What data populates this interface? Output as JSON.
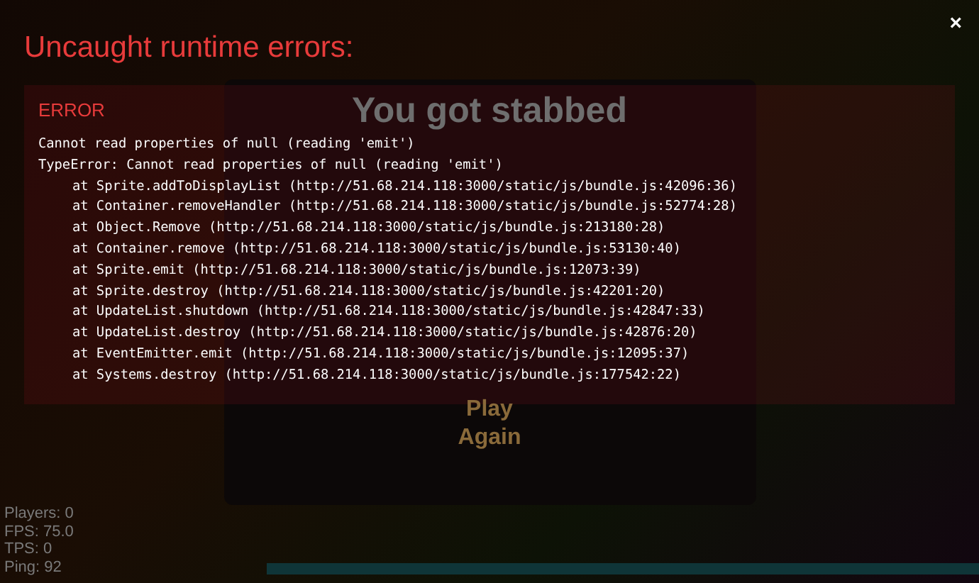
{
  "game": {
    "death_title": "You got stabbed",
    "play_button": "Play\nAgain",
    "stats": [
      "Players: 0",
      "FPS: 75.0",
      "TPS: 0",
      "Ping: 92"
    ]
  },
  "overlay": {
    "title": "Uncaught runtime errors:",
    "close": "×",
    "errors": [
      {
        "heading": "ERROR",
        "lines": [
          {
            "text": "Cannot read properties of null (reading 'emit')",
            "kind": "message"
          },
          {
            "text": "TypeError: Cannot read properties of null (reading 'emit')",
            "kind": "message"
          },
          {
            "text": "at Sprite.addToDisplayList (http://51.68.214.118:3000/static/js/bundle.js:42096:36)",
            "kind": "frame"
          },
          {
            "text": "at Container.removeHandler (http://51.68.214.118:3000/static/js/bundle.js:52774:28)",
            "kind": "frame"
          },
          {
            "text": "at Object.Remove (http://51.68.214.118:3000/static/js/bundle.js:213180:28)",
            "kind": "frame"
          },
          {
            "text": "at Container.remove (http://51.68.214.118:3000/static/js/bundle.js:53130:40)",
            "kind": "frame"
          },
          {
            "text": "at Sprite.emit (http://51.68.214.118:3000/static/js/bundle.js:12073:39)",
            "kind": "frame"
          },
          {
            "text": "at Sprite.destroy (http://51.68.214.118:3000/static/js/bundle.js:42201:20)",
            "kind": "frame"
          },
          {
            "text": "at UpdateList.shutdown (http://51.68.214.118:3000/static/js/bundle.js:42847:33)",
            "kind": "frame"
          },
          {
            "text": "at UpdateList.destroy (http://51.68.214.118:3000/static/js/bundle.js:42876:20)",
            "kind": "frame"
          },
          {
            "text": "at EventEmitter.emit (http://51.68.214.118:3000/static/js/bundle.js:12095:37)",
            "kind": "frame"
          },
          {
            "text": "at Systems.destroy (http://51.68.214.118:3000/static/js/bundle.js:177542:22)",
            "kind": "frame"
          }
        ]
      }
    ]
  }
}
